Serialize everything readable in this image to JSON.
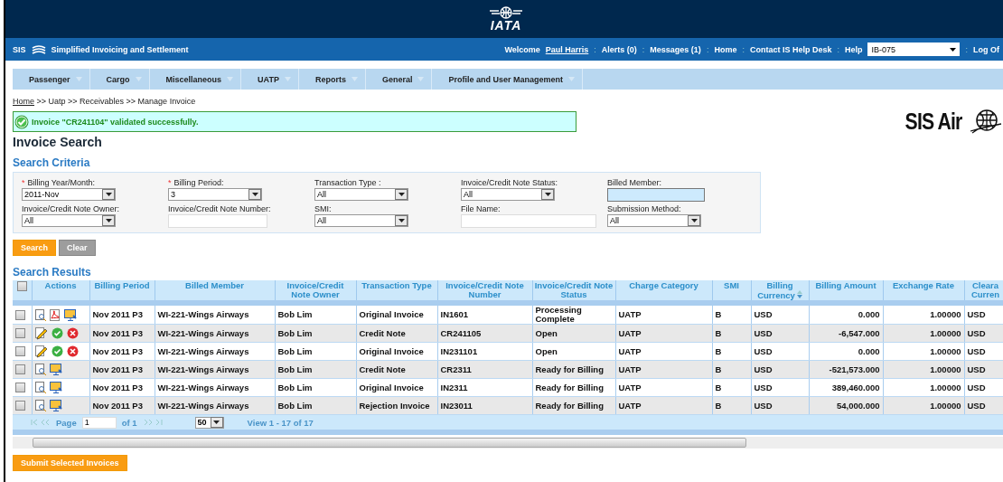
{
  "header": {
    "logo_text": "IATA"
  },
  "top_bar": {
    "brand": "SIS",
    "app_title": "Simplified Invoicing and Settlement",
    "welcome": "Welcome",
    "user": "Paul Harris",
    "links": [
      "Alerts (0)",
      "Messages (1)",
      "Home",
      "Contact IS Help Desk",
      "Help"
    ],
    "separator": ":",
    "member_select": "IB-075",
    "logoff": "Log Of"
  },
  "menu": [
    "Passenger",
    "Cargo",
    "Miscellaneous",
    "UATP",
    "Reports",
    "General",
    "Profile and User Management"
  ],
  "breadcrumb": {
    "home": "Home",
    "rest": ">> Uatp >> Receivables >> Manage Invoice"
  },
  "message": "Invoice \"CR241104\" validated successfully.",
  "brand_logo": "SIS Air",
  "page_title": "Invoice Search",
  "criteria_title": "Search Criteria",
  "filters": [
    {
      "label": "Billing Year/Month:",
      "required_mark": "*",
      "kind": "select",
      "value": "2011-Nov"
    },
    {
      "label": "Billing Period:",
      "required_mark": "*",
      "kind": "select",
      "value": "3"
    },
    {
      "label": "Transaction Type :",
      "kind": "select",
      "value": "All"
    },
    {
      "label": "Invoice/Credit Note Status:",
      "kind": "select",
      "value": "All"
    },
    {
      "label": "Billed Member:",
      "kind": "text",
      "focused": true
    },
    {
      "label": "Invoice/Credit Note Owner:",
      "kind": "select",
      "value": "All"
    },
    {
      "label": "Invoice/Credit Note Number:",
      "kind": "text",
      "focused": false
    },
    {
      "label": "SMI:",
      "kind": "select",
      "value": "All"
    },
    {
      "label": "File Name:",
      "kind": "wide_text",
      "focused": false
    },
    {
      "label": "Submission Method:",
      "kind": "select",
      "value": "All"
    }
  ],
  "buttons": [
    {
      "label": "Search",
      "kind": "primary"
    },
    {
      "label": "Clear",
      "kind": "secondary"
    }
  ],
  "results_title": "Search Results",
  "table": {
    "select_all_checked": false,
    "actions_header": "Actions",
    "columns": [
      "Billing Period",
      "Billed Member",
      "Invoice/Credit Note Owner",
      "Transaction Type",
      "Invoice/Credit Note Number",
      "Invoice/Credit Note Status",
      "Charge Category",
      "SMI",
      "Billing Currency",
      "Billing Amount",
      "Exchange Rate",
      "Cleara Curren"
    ],
    "rows": [
      {
        "checked": false,
        "actions": [
          {
            "kind": "view"
          },
          {
            "kind": "pdf"
          },
          {
            "kind": "monitor"
          }
        ],
        "cells": [
          "Nov 2011 P3",
          "WI-221-Wings Airways",
          "Bob Lim",
          "Original Invoice",
          "IN1601",
          "Processing Complete",
          "UATP",
          "B",
          "USD",
          "0.000",
          "1.00000",
          "USD"
        ]
      },
      {
        "checked": false,
        "actions": [
          {
            "kind": "edit"
          },
          {
            "kind": "validate"
          },
          {
            "kind": "delete"
          }
        ],
        "cells": [
          "Nov 2011 P3",
          "WI-221-Wings Airways",
          "Bob Lim",
          "Credit Note",
          "CR241105",
          "Open",
          "UATP",
          "B",
          "USD",
          "-6,547.000",
          "1.00000",
          "USD"
        ]
      },
      {
        "checked": false,
        "actions": [
          {
            "kind": "edit"
          },
          {
            "kind": "validate"
          },
          {
            "kind": "delete"
          }
        ],
        "cells": [
          "Nov 2011 P3",
          "WI-221-Wings Airways",
          "Bob Lim",
          "Original Invoice",
          "IN231101",
          "Open",
          "UATP",
          "B",
          "USD",
          "0.000",
          "1.00000",
          "USD"
        ]
      },
      {
        "checked": false,
        "actions": [
          {
            "kind": "view"
          },
          {
            "kind": "monitor"
          }
        ],
        "cells": [
          "Nov 2011 P3",
          "WI-221-Wings Airways",
          "Bob Lim",
          "Credit Note",
          "CR2311",
          "Ready for Billing",
          "UATP",
          "B",
          "USD",
          "-521,573.000",
          "1.00000",
          "USD"
        ]
      },
      {
        "checked": false,
        "actions": [
          {
            "kind": "view"
          },
          {
            "kind": "monitor"
          }
        ],
        "cells": [
          "Nov 2011 P3",
          "WI-221-Wings Airways",
          "Bob Lim",
          "Original Invoice",
          "IN2311",
          "Ready for Billing",
          "UATP",
          "B",
          "USD",
          "389,460.000",
          "1.00000",
          "USD"
        ]
      },
      {
        "checked": false,
        "actions": [
          {
            "kind": "view"
          },
          {
            "kind": "monitor"
          }
        ],
        "cells": [
          "Nov 2011 P3",
          "WI-221-Wings Airways",
          "Bob Lim",
          "Rejection Invoice",
          "IN23011",
          "Ready for Billing",
          "UATP",
          "B",
          "USD",
          "54,000.000",
          "1.00000",
          "USD"
        ]
      }
    ]
  },
  "pager": {
    "page_label": "Page",
    "page": "1",
    "of": "of 1",
    "page_size": "50",
    "view": "View 1 - 17 of 17"
  },
  "submit_button": "Submit Selected Invoices"
}
